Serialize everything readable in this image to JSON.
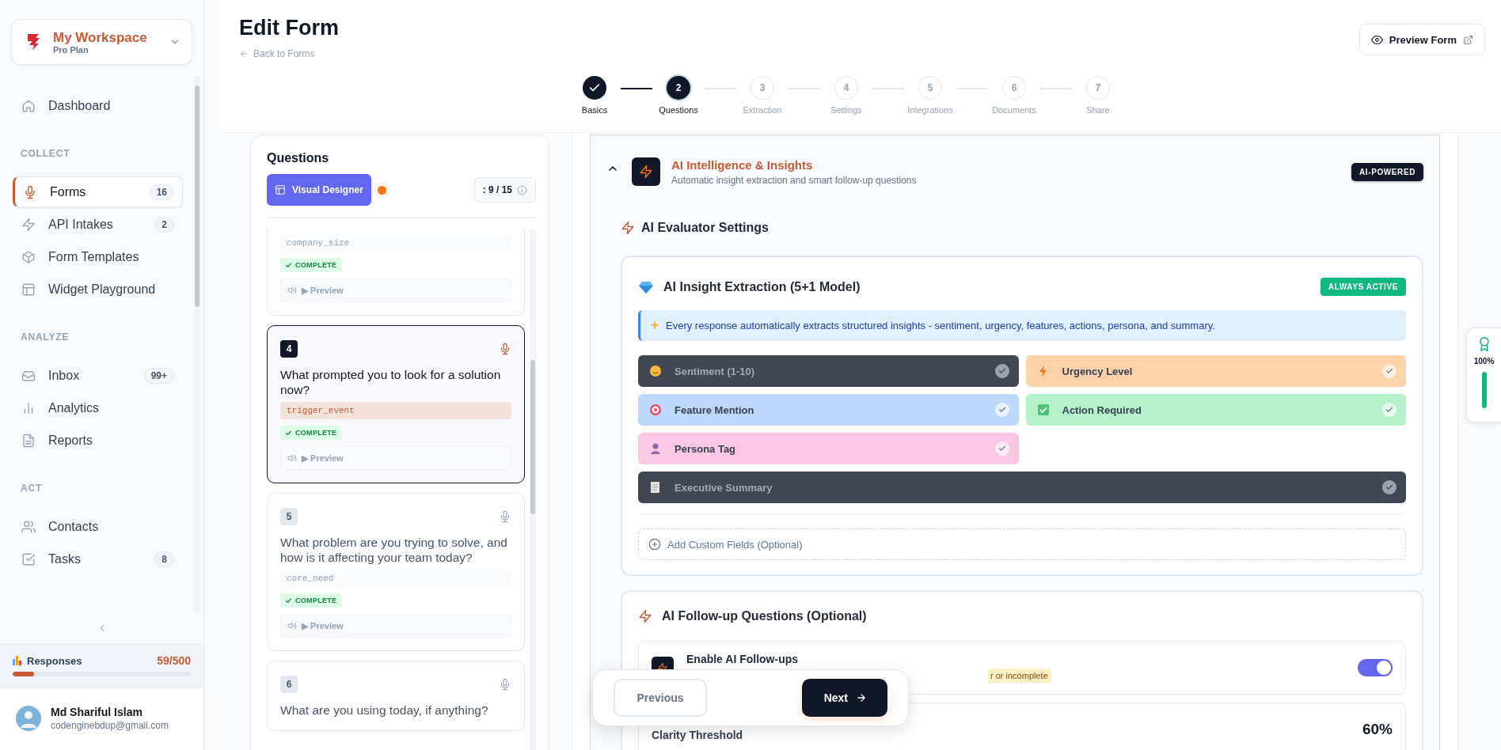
{
  "sidebar": {
    "workspace": {
      "name": "My Workspace",
      "plan": "Pro Plan"
    },
    "top_items": [
      {
        "label": "Dashboard",
        "selected": false
      }
    ],
    "sections": [
      {
        "title": "COLLECT",
        "items": [
          {
            "label": "Forms",
            "badge": "16",
            "selected": true
          },
          {
            "label": "API Intakes",
            "badge": "2",
            "selected": false
          },
          {
            "label": "Form Templates",
            "selected": false
          },
          {
            "label": "Widget Playground",
            "selected": false
          }
        ]
      },
      {
        "title": "ANALYZE",
        "items": [
          {
            "label": "Inbox",
            "badge": "99+",
            "selected": false
          },
          {
            "label": "Analytics",
            "selected": false
          },
          {
            "label": "Reports",
            "selected": false
          }
        ]
      },
      {
        "title": "ACT",
        "items": [
          {
            "label": "Contacts",
            "selected": false
          },
          {
            "label": "Tasks",
            "badge": "8",
            "selected": false
          }
        ]
      }
    ],
    "usage": {
      "label": "Responses",
      "reading": "59/500",
      "level": 0.118
    },
    "user": {
      "name": "Md Shariful Islam",
      "email": "codenginebdup@gmail.com"
    }
  },
  "header": {
    "title": "Edit Form",
    "back_link": "Back to Forms",
    "preview_button": "Preview Form"
  },
  "steps": [
    {
      "label": "Basics",
      "completed": true,
      "selected": false
    },
    {
      "number": "2",
      "label": "Questions",
      "completed": false,
      "selected": true
    },
    {
      "number": "3",
      "label": "Extraction",
      "completed": false,
      "selected": false
    },
    {
      "number": "4",
      "label": "Settings",
      "completed": false,
      "selected": false
    },
    {
      "number": "5",
      "label": "Integrations",
      "completed": false,
      "selected": false
    },
    {
      "number": "6",
      "label": "Documents",
      "completed": false,
      "selected": false
    },
    {
      "number": "7",
      "label": "Share",
      "completed": false,
      "selected": false
    }
  ],
  "questions_panel": {
    "title": "Questions",
    "designer_button": "Visual Designer",
    "counter": ": 9 / 15",
    "questions": [
      {
        "field": "company_size",
        "status": "COMPLETE",
        "preview": "▶ Preview",
        "selected": false
      },
      {
        "number": "4",
        "question": "What prompted you to look for a solution now?",
        "field": "trigger_event",
        "status": "COMPLETE",
        "preview": "▶ Preview",
        "selected": true
      },
      {
        "number": "5",
        "question": "What problem are you trying to solve, and how is it affecting your team today?",
        "field": "core_need",
        "status": "COMPLETE",
        "preview": "▶ Preview",
        "selected": false
      },
      {
        "number": "6",
        "question": "What are you using today, if anything?",
        "selected": false
      }
    ]
  },
  "ai_section": {
    "expanded": true,
    "title": "AI Intelligence & Insights",
    "subtitle": "Automatic insight extraction and smart follow-up questions",
    "badge": "AI-POWERED",
    "evaluator_title": "AI Evaluator Settings",
    "extraction": {
      "title": "AI Insight Extraction (5+1 Model)",
      "badge": "ALWAYS ACTIVE",
      "info": "Every response automatically extracts structured insights - sentiment, urgency, features, actions, persona, and summary.",
      "fields": [
        {
          "label": "Sentiment (1-10)",
          "enabled": false,
          "wide": false
        },
        {
          "label": "Urgency Level",
          "enabled": true,
          "wide": false,
          "color": "#fcd3a8"
        },
        {
          "label": "Feature Mention",
          "enabled": true,
          "wide": false,
          "color": "#bcd9fb"
        },
        {
          "label": "Action Required",
          "enabled": true,
          "wide": false,
          "color": "#b5f2cc"
        },
        {
          "label": "Persona Tag",
          "enabled": true,
          "wide": false,
          "color": "#f9c8e2"
        },
        {
          "label": "Executive Summary",
          "enabled": false,
          "wide": true
        }
      ],
      "add_button": "Add Custom Fields (Optional)"
    },
    "followup": {
      "title": "AI Follow-up Questions (Optional)",
      "toggle_label": "Enable AI Follow-ups",
      "toggle_hint": "r or incomplete",
      "on": true,
      "threshold_label": "Clarity Threshold",
      "threshold_value": "60%"
    }
  },
  "nav": {
    "previous": "Previous",
    "next": "Next"
  },
  "score": {
    "reading": "100%",
    "level": 1
  }
}
